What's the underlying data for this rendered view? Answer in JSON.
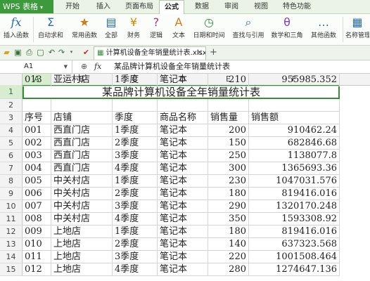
{
  "app": {
    "name": "WPS 表格"
  },
  "menu": [
    "开始",
    "插入",
    "页面布局",
    "公式",
    "数据",
    "审阅",
    "视图",
    "特色功能"
  ],
  "active_menu": "公式",
  "ribbon": [
    {
      "label": "插入函数",
      "icon": "fx"
    },
    {
      "label": "自动求和",
      "icon": "Σ"
    },
    {
      "label": "常用函数",
      "icon": "★"
    },
    {
      "label": "全部",
      "icon": "▤"
    },
    {
      "label": "财务",
      "icon": "¥"
    },
    {
      "label": "逻辑",
      "icon": "?"
    },
    {
      "label": "文本",
      "icon": "A"
    },
    {
      "label": "日期和时间",
      "icon": "◷"
    },
    {
      "label": "查找与引用",
      "icon": "⌕"
    },
    {
      "label": "数学和三角",
      "icon": "θ"
    },
    {
      "label": "其他函数",
      "icon": "…"
    },
    {
      "label": "名称管理",
      "icon": "▦"
    }
  ],
  "document": {
    "tab_title": "计算机设备全年销量统计表.xlsx *"
  },
  "formula_bar": {
    "cell_ref": "A1",
    "fx": "fx",
    "content": "某品牌计算机设备全年销量统计表"
  },
  "columns": [
    "A",
    "B",
    "C",
    "D",
    "E",
    "F"
  ],
  "rows": [
    "1",
    "2",
    "3",
    "4",
    "5",
    "6",
    "7",
    "8",
    "9",
    "10",
    "11",
    "12",
    "13",
    "14",
    "15"
  ],
  "sheet": {
    "title": "某品牌计算机设备全年销量统计表",
    "headers": [
      "序号",
      "店铺",
      "季度",
      "商品名称",
      "销售量",
      "销售额"
    ],
    "data": [
      [
        "001",
        "西直门店",
        "1季度",
        "笔记本",
        "200",
        "910462.24"
      ],
      [
        "002",
        "西直门店",
        "2季度",
        "笔记本",
        "150",
        "682846.68"
      ],
      [
        "003",
        "西直门店",
        "3季度",
        "笔记本",
        "250",
        "1138077.8"
      ],
      [
        "004",
        "西直门店",
        "4季度",
        "笔记本",
        "300",
        "1365693.36"
      ],
      [
        "005",
        "中关村店",
        "1季度",
        "笔记本",
        "230",
        "1047031.576"
      ],
      [
        "006",
        "中关村店",
        "2季度",
        "笔记本",
        "180",
        "819416.016"
      ],
      [
        "007",
        "中关村店",
        "3季度",
        "笔记本",
        "290",
        "1320170.248"
      ],
      [
        "008",
        "中关村店",
        "4季度",
        "笔记本",
        "350",
        "1593308.92"
      ],
      [
        "009",
        "上地店",
        "1季度",
        "笔记本",
        "180",
        "819416.016"
      ],
      [
        "010",
        "上地店",
        "2季度",
        "笔记本",
        "140",
        "637323.568"
      ],
      [
        "011",
        "上地店",
        "3季度",
        "笔记本",
        "220",
        "1001508.464"
      ],
      [
        "012",
        "上地店",
        "4季度",
        "笔记本",
        "280",
        "1274647.136"
      ],
      [
        "013",
        "亚运村店",
        "1季度",
        "笔记本",
        "210",
        "955985.352"
      ]
    ]
  },
  "colors": {
    "accent": "#3c9a3c",
    "header_bg": "#f3f3f3",
    "selection": "#d8ecd0"
  }
}
